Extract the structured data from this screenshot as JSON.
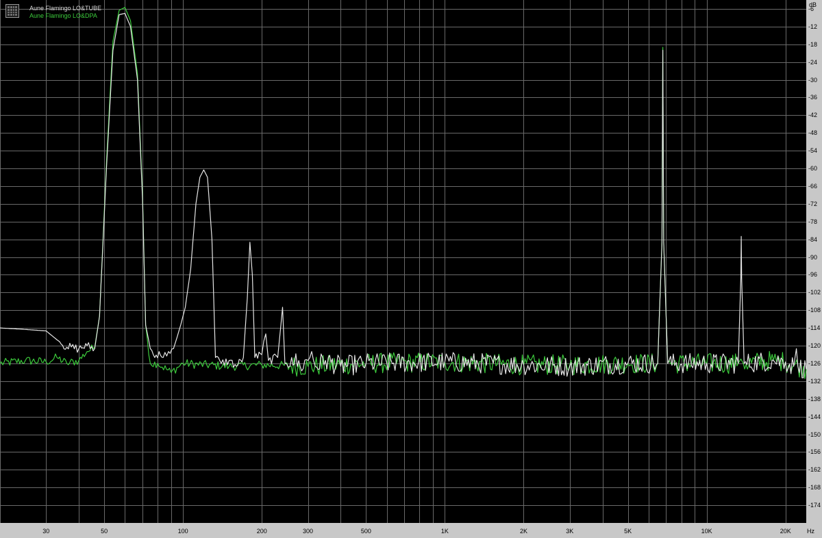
{
  "chart_data": {
    "type": "line",
    "title": "",
    "xlabel": "",
    "ylabel": "",
    "x_unit": "Hz",
    "y_unit": "dB",
    "x_scale": "log",
    "xlim": [
      20,
      24000
    ],
    "ylim": [
      -180,
      -3
    ],
    "grid": true,
    "legend_position": "top-left",
    "background_color": "#000000",
    "grid_color": "#6a6a6a",
    "axis_bg_color": "#c8c8c8",
    "x_tick_labels": [
      {
        "value": 30,
        "label": "30"
      },
      {
        "value": 50,
        "label": "50"
      },
      {
        "value": 100,
        "label": "100"
      },
      {
        "value": 200,
        "label": "200"
      },
      {
        "value": 300,
        "label": "300"
      },
      {
        "value": 500,
        "label": "500"
      },
      {
        "value": 1000,
        "label": "1K"
      },
      {
        "value": 2000,
        "label": "2K"
      },
      {
        "value": 3000,
        "label": "3K"
      },
      {
        "value": 5000,
        "label": "5K"
      },
      {
        "value": 10000,
        "label": "10K"
      },
      {
        "value": 20000,
        "label": "20K"
      }
    ],
    "x_minor_gridlines": [
      20,
      40,
      60,
      70,
      80,
      90,
      400,
      600,
      700,
      800,
      900,
      4000,
      6000,
      7000,
      8000,
      9000
    ],
    "y_ticks": [
      -6,
      -12,
      -18,
      -24,
      -30,
      -36,
      -42,
      -48,
      -54,
      -60,
      -66,
      -72,
      -78,
      -84,
      -90,
      -96,
      -102,
      -108,
      -114,
      -120,
      -126,
      -132,
      -138,
      -144,
      -150,
      -156,
      -162,
      -168,
      -174
    ],
    "series": [
      {
        "name": "Aune Flamingo LO&TUBE",
        "color": "#e6e6e6",
        "noise_floor_db": -126,
        "points": [
          [
            20,
            -114
          ],
          [
            25,
            -114.5
          ],
          [
            30,
            -115
          ],
          [
            33,
            -118
          ],
          [
            36,
            -120.5
          ],
          [
            40,
            -121
          ],
          [
            43,
            -120
          ],
          [
            46,
            -121
          ],
          [
            48,
            -110
          ],
          [
            51,
            -60
          ],
          [
            54,
            -20
          ],
          [
            57,
            -8
          ],
          [
            60,
            -7.5
          ],
          [
            63,
            -12
          ],
          [
            67,
            -30
          ],
          [
            70,
            -70
          ],
          [
            72,
            -113
          ],
          [
            75,
            -121
          ],
          [
            78,
            -124
          ],
          [
            81,
            -122
          ],
          [
            84,
            -124
          ],
          [
            88,
            -122
          ],
          [
            92,
            -121
          ],
          [
            95,
            -117
          ],
          [
            98,
            -113
          ],
          [
            102,
            -107
          ],
          [
            107,
            -94
          ],
          [
            112,
            -72
          ],
          [
            116,
            -63
          ],
          [
            120,
            -60.5
          ],
          [
            124,
            -63
          ],
          [
            129,
            -84
          ],
          [
            133,
            -124
          ],
          [
            140,
            -126
          ],
          [
            150,
            -125
          ],
          [
            160,
            -127
          ],
          [
            170,
            -124
          ],
          [
            176,
            -104
          ],
          [
            180,
            -85
          ],
          [
            184,
            -96
          ],
          [
            188,
            -124
          ],
          [
            200,
            -123
          ],
          [
            207,
            -116
          ],
          [
            212,
            -125
          ],
          [
            230,
            -124
          ],
          [
            240,
            -107
          ],
          [
            245,
            -126
          ],
          [
            260,
            -124
          ],
          [
            280,
            -127
          ],
          [
            300,
            -125
          ],
          [
            310,
            -122
          ],
          [
            320,
            -127
          ],
          [
            350,
            -125
          ],
          [
            400,
            -127
          ],
          [
            500,
            -126
          ],
          [
            1000,
            -125.5
          ],
          [
            2000,
            -126.5
          ],
          [
            3000,
            -127
          ],
          [
            5000,
            -126
          ],
          [
            6500,
            -126
          ],
          [
            6750,
            -85
          ],
          [
            6800,
            -20
          ],
          [
            6850,
            -85
          ],
          [
            7100,
            -126
          ],
          [
            10000,
            -126
          ],
          [
            13200,
            -126
          ],
          [
            13500,
            -97
          ],
          [
            13550,
            -83
          ],
          [
            13600,
            -97
          ],
          [
            13900,
            -126
          ],
          [
            18000,
            -125
          ],
          [
            20000,
            -125.5
          ],
          [
            21500,
            -127
          ],
          [
            22000,
            -121
          ],
          [
            22300,
            -127
          ],
          [
            24000,
            -128
          ]
        ]
      },
      {
        "name": "Aune Flamingo LO&DPA",
        "color": "#3ccb3c",
        "noise_floor_db": -126,
        "points": [
          [
            20,
            -126
          ],
          [
            25,
            -125
          ],
          [
            30,
            -125.5
          ],
          [
            33,
            -124
          ],
          [
            36,
            -126
          ],
          [
            40,
            -125
          ],
          [
            43,
            -122
          ],
          [
            46,
            -120.5
          ],
          [
            48,
            -110
          ],
          [
            51,
            -58
          ],
          [
            54,
            -17
          ],
          [
            57,
            -6.5
          ],
          [
            60,
            -5.5
          ],
          [
            63,
            -10
          ],
          [
            67,
            -28
          ],
          [
            70,
            -68
          ],
          [
            72,
            -113
          ],
          [
            75,
            -126
          ],
          [
            80,
            -126
          ],
          [
            90,
            -129
          ],
          [
            100,
            -126
          ],
          [
            150,
            -127
          ],
          [
            200,
            -126.5
          ],
          [
            300,
            -127
          ],
          [
            500,
            -126
          ],
          [
            1000,
            -125.5
          ],
          [
            2000,
            -126.5
          ],
          [
            3000,
            -126.5
          ],
          [
            5000,
            -126
          ],
          [
            6500,
            -126
          ],
          [
            6750,
            -85
          ],
          [
            6800,
            -19
          ],
          [
            6850,
            -85
          ],
          [
            7100,
            -126
          ],
          [
            10000,
            -126
          ],
          [
            13200,
            -126
          ],
          [
            13500,
            -124.5
          ],
          [
            13800,
            -126
          ],
          [
            18000,
            -125
          ],
          [
            20000,
            -125.5
          ],
          [
            24000,
            -128
          ]
        ]
      }
    ]
  }
}
